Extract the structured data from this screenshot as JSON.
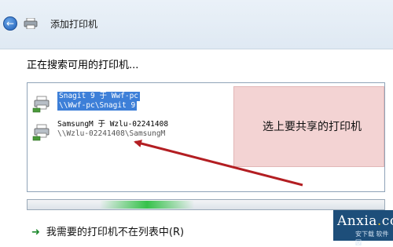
{
  "window": {
    "title": "添加打印机",
    "back_glyph": "←"
  },
  "search": {
    "heading": "正在搜索可用的打印机..."
  },
  "printers": [
    {
      "name": "Snagit 9 于 Wwf-pc",
      "path": "\\\\Wwf-pc\\Snagit 9",
      "selected": true
    },
    {
      "name": "SamsungM 于 Wzlu-02241408",
      "path": "\\\\Wzlu-02241408\\SamsungM",
      "selected": false
    }
  ],
  "callout": {
    "text": "选上要共享的打印机"
  },
  "footer": {
    "missing_printer_link": "我需要的打印机不在列表中(R)",
    "link_glyph": "➜"
  },
  "watermark": {
    "logo_main": "Anxia",
    "logo_dot": ".",
    "logo_tld": "com",
    "sub": "安下载 软件园"
  },
  "colors": {
    "selection": "#3d7fd8",
    "callout_bg": "#f3d3d3",
    "arrow": "#b31e22",
    "progress_glow": "#36c24a"
  }
}
